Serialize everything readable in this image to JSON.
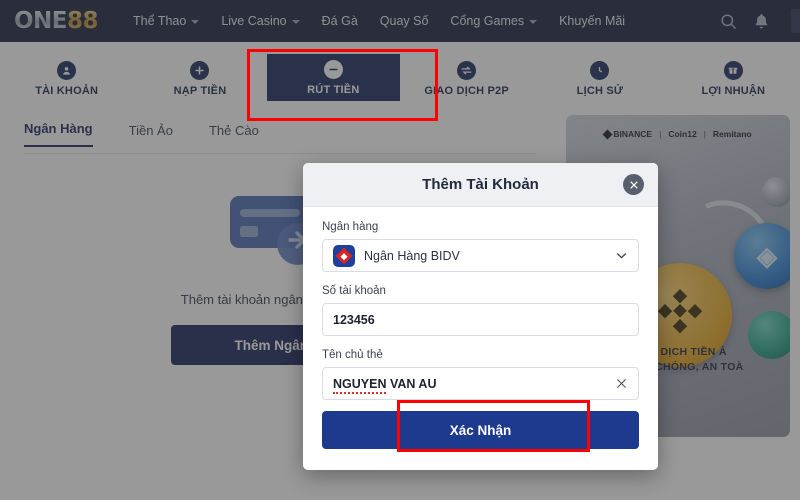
{
  "brand": {
    "name_part1": "ONE",
    "name_part2": "88"
  },
  "topnav": {
    "items": [
      {
        "label": "Thể Thao",
        "has_caret": true
      },
      {
        "label": "Live Casino",
        "has_caret": true
      },
      {
        "label": "Đá Gà",
        "has_caret": false
      },
      {
        "label": "Quay Số",
        "has_caret": false
      },
      {
        "label": "Cổng Games",
        "has_caret": true
      },
      {
        "label": "Khuyến Mãi",
        "has_caret": false
      }
    ],
    "search_icon": "search-icon",
    "bell_icon": "bell-icon"
  },
  "tabs": [
    {
      "label": "TÀI KHOẢN",
      "icon": "user-circle-icon",
      "active": false
    },
    {
      "label": "NẠP TIỀN",
      "icon": "plus-circle-icon",
      "active": false
    },
    {
      "label": "RÚT TIỀN",
      "icon": "minus-circle-icon",
      "active": true
    },
    {
      "label": "GIAO DỊCH P2P",
      "icon": "exchange-icon",
      "active": false
    },
    {
      "label": "LỊCH SỬ",
      "icon": "clock-icon",
      "active": false
    },
    {
      "label": "LỢI NHUẬN",
      "icon": "gift-icon",
      "active": false
    }
  ],
  "subtabs": [
    {
      "label": "Ngân Hàng",
      "active": true
    },
    {
      "label": "Tiền Ảo",
      "active": false
    },
    {
      "label": "Thẻ Cào",
      "active": false
    }
  ],
  "empty_state": {
    "illustration": "credit-card-icon",
    "text": "Thêm tài khoản ngân hàng để bắt",
    "button_label": "Thêm Ngân H"
  },
  "banner": {
    "logos": [
      "BINANCE",
      "Coin12",
      "Remitano"
    ],
    "separator": "|",
    "line1": "GIAO DỊCH TIỀN Ả",
    "line2": "NHANH CHÓNG, AN TOÀ"
  },
  "modal": {
    "title": "Thêm Tài Khoản",
    "close_icon": "close-icon",
    "bank_label": "Ngân hàng",
    "bank_value": "Ngân Hàng BIDV",
    "bank_logo": "bidv-logo-icon",
    "dropdown_icon": "chevron-down-icon",
    "account_label": "Số tài khoản",
    "account_value": "123456",
    "holder_label": "Tên chủ thẻ",
    "holder_value_misspelled": "NGUYEN",
    "holder_value_rest": " VAN AU",
    "clear_icon": "close-x-icon",
    "confirm_label": "Xác Nhận"
  },
  "annotations": {
    "box1_target": "RÚT TIỀN",
    "box2_target": "Xác Nhận",
    "color": "#ff0000"
  },
  "colors": {
    "nav_bg": "#171e3c",
    "accent": "#17235a",
    "primary_button": "#1e3a8f",
    "gold": "#b8862a",
    "annotation": "#ff0000"
  }
}
